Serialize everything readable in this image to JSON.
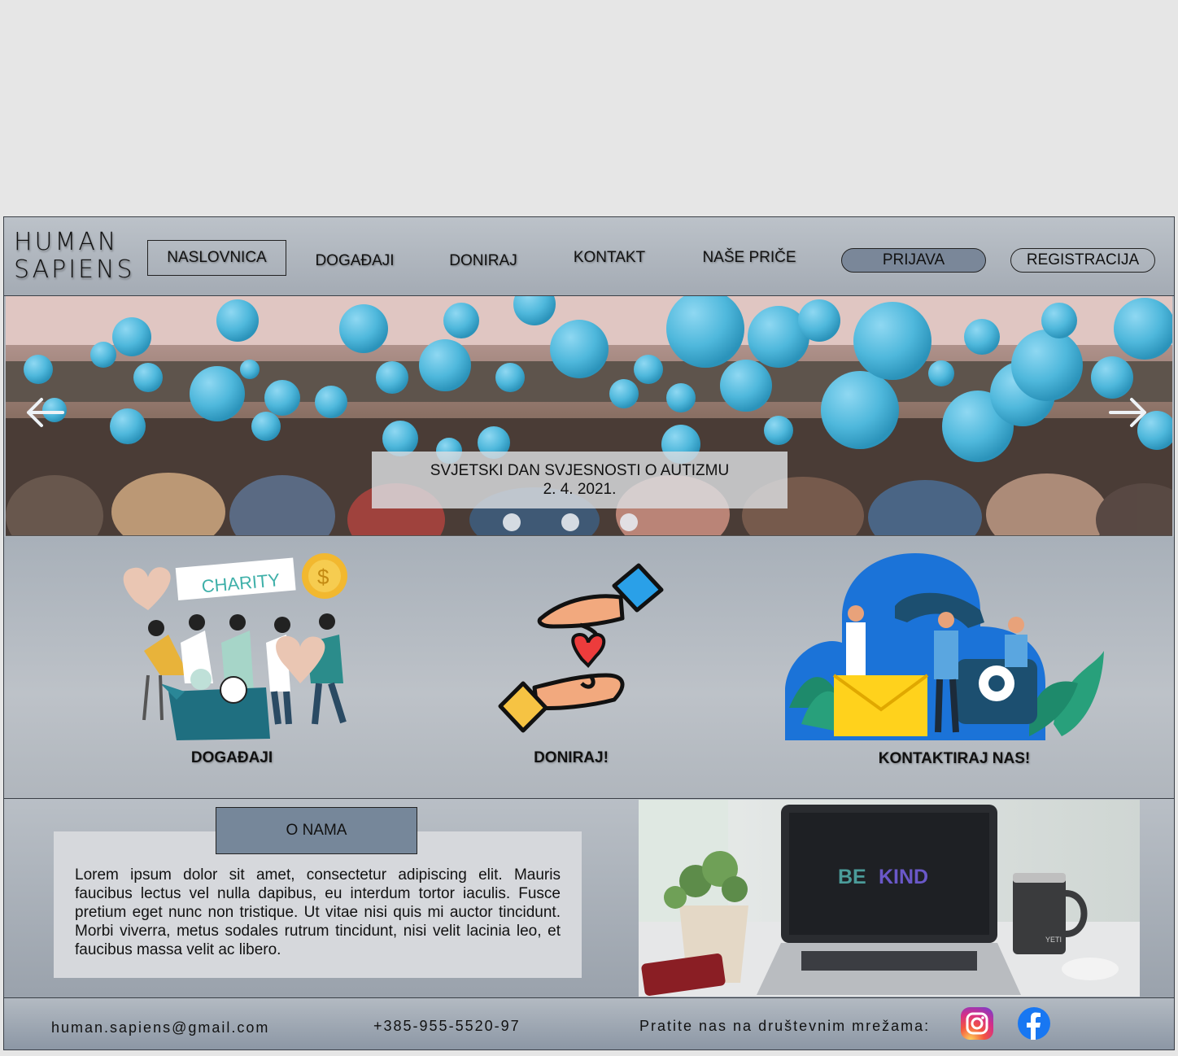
{
  "header": {
    "logo_line1": "HUMAN",
    "logo_line2": "SAPIENS",
    "nav": [
      "NASLOVNICA",
      "DOGAĐAJI",
      "DONIRAJ",
      "KONTAKT",
      "NAŠE PRIČE"
    ],
    "login": "PRIJAVA",
    "register": "REGISTRACIJA"
  },
  "hero": {
    "title": "SVJETSKI DAN SVJESNOSTI O AUTIZMU",
    "date": "2. 4. 2021."
  },
  "features": {
    "events": {
      "label": "DOGAĐAJI",
      "banner": "CHARITY"
    },
    "donate": {
      "label": "DONIRAJ!"
    },
    "contact": {
      "label": "KONTAKTIRAJ NAS!"
    }
  },
  "about": {
    "title": "O NAMA",
    "text": "Lorem ipsum dolor sit amet, consectetur adipiscing elit. Mauris faucibus lectus vel nulla dapibus, eu interdum tortor iaculis. Fusce pretium eget nunc non tristique. Ut vitae nisi quis mi auctor tincidunt. Morbi viverra, metus sodales rutrum tincidunt, nisi velit lacinia leo, et faucibus massa velit ac libero.",
    "laptop_be": "BE",
    "laptop_kind": "KIND",
    "mug_brand": "YETI"
  },
  "footer": {
    "email": "human.sapiens@gmail.com",
    "phone": "+385-955-5520-97",
    "social_label": "Pratite nas na društevnim mrežama:",
    "icons": [
      "instagram-icon",
      "facebook-icon"
    ]
  },
  "colors": {
    "balloon": "#4fb8dc",
    "title_box": "#76879a",
    "facebook": "#1877f2"
  }
}
